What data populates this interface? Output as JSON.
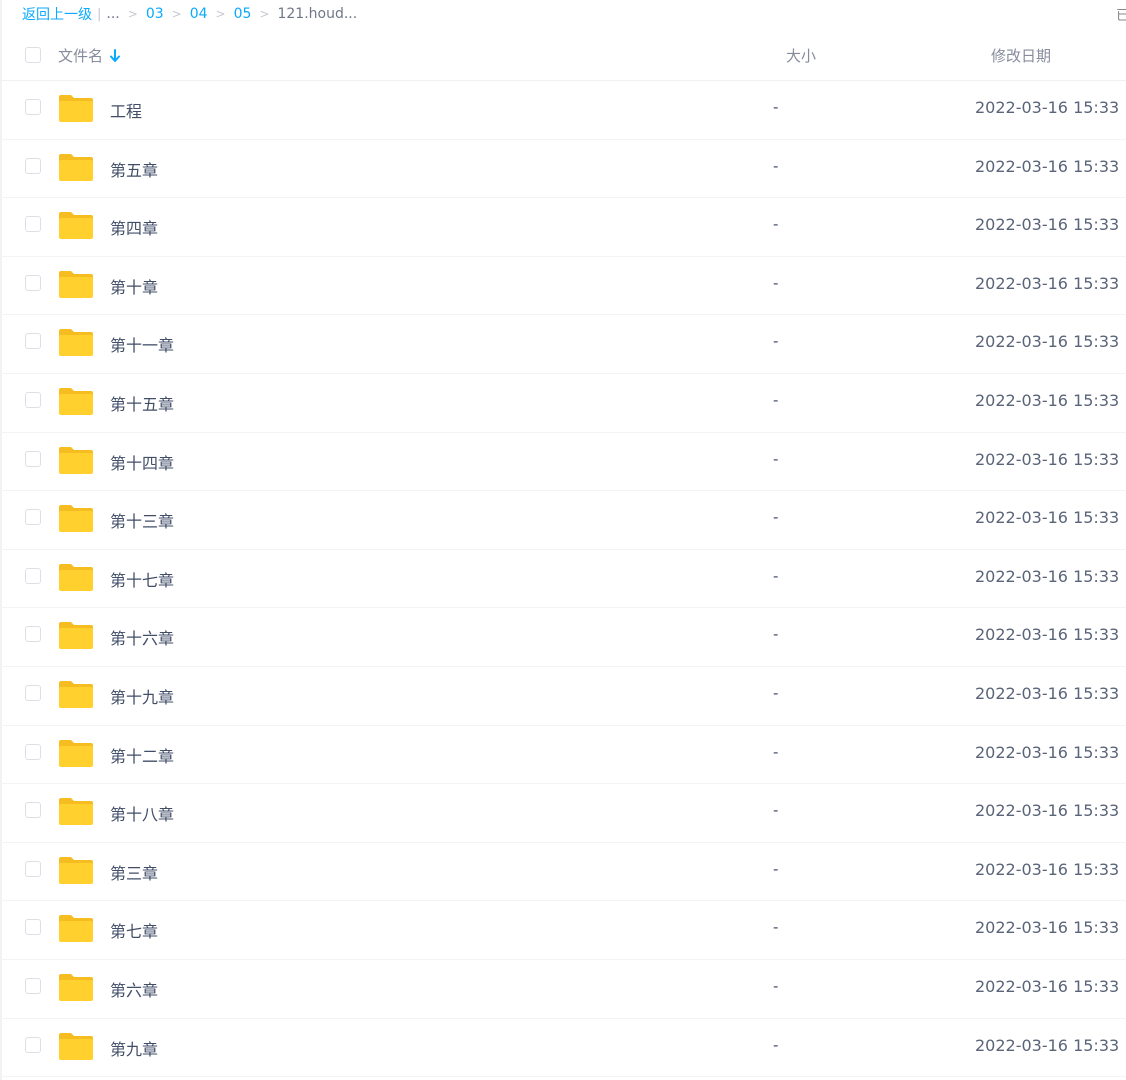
{
  "breadcrumb": {
    "back_label": "返回上一级",
    "separator": "|",
    "ellipsis": "...",
    "crumb_sep": ">",
    "items": [
      "03",
      "04",
      "05"
    ],
    "current": "121.houd..."
  },
  "corner_text": "已",
  "header": {
    "name_label": "文件名",
    "size_label": "大小",
    "date_label": "修改日期",
    "sort_direction": "descending"
  },
  "colors": {
    "accent": "#09aaff",
    "folder": "#ffd02e",
    "folder_back": "#f5bd1f"
  },
  "files": [
    {
      "name": "工程",
      "size": "-",
      "date": "2022-03-16 15:33",
      "icon": "folder-icon"
    },
    {
      "name": "第五章",
      "size": "-",
      "date": "2022-03-16 15:33",
      "icon": "folder-icon"
    },
    {
      "name": "第四章",
      "size": "-",
      "date": "2022-03-16 15:33",
      "icon": "folder-icon"
    },
    {
      "name": "第十章",
      "size": "-",
      "date": "2022-03-16 15:33",
      "icon": "folder-icon"
    },
    {
      "name": "第十一章",
      "size": "-",
      "date": "2022-03-16 15:33",
      "icon": "folder-icon"
    },
    {
      "name": "第十五章",
      "size": "-",
      "date": "2022-03-16 15:33",
      "icon": "folder-icon"
    },
    {
      "name": "第十四章",
      "size": "-",
      "date": "2022-03-16 15:33",
      "icon": "folder-icon"
    },
    {
      "name": "第十三章",
      "size": "-",
      "date": "2022-03-16 15:33",
      "icon": "folder-icon"
    },
    {
      "name": "第十七章",
      "size": "-",
      "date": "2022-03-16 15:33",
      "icon": "folder-icon"
    },
    {
      "name": "第十六章",
      "size": "-",
      "date": "2022-03-16 15:33",
      "icon": "folder-icon"
    },
    {
      "name": "第十九章",
      "size": "-",
      "date": "2022-03-16 15:33",
      "icon": "folder-icon"
    },
    {
      "name": "第十二章",
      "size": "-",
      "date": "2022-03-16 15:33",
      "icon": "folder-icon"
    },
    {
      "name": "第十八章",
      "size": "-",
      "date": "2022-03-16 15:33",
      "icon": "folder-icon"
    },
    {
      "name": "第三章",
      "size": "-",
      "date": "2022-03-16 15:33",
      "icon": "folder-icon"
    },
    {
      "name": "第七章",
      "size": "-",
      "date": "2022-03-16 15:33",
      "icon": "folder-icon"
    },
    {
      "name": "第六章",
      "size": "-",
      "date": "2022-03-16 15:33",
      "icon": "folder-icon"
    },
    {
      "name": "第九章",
      "size": "-",
      "date": "2022-03-16 15:33",
      "icon": "folder-icon"
    }
  ]
}
